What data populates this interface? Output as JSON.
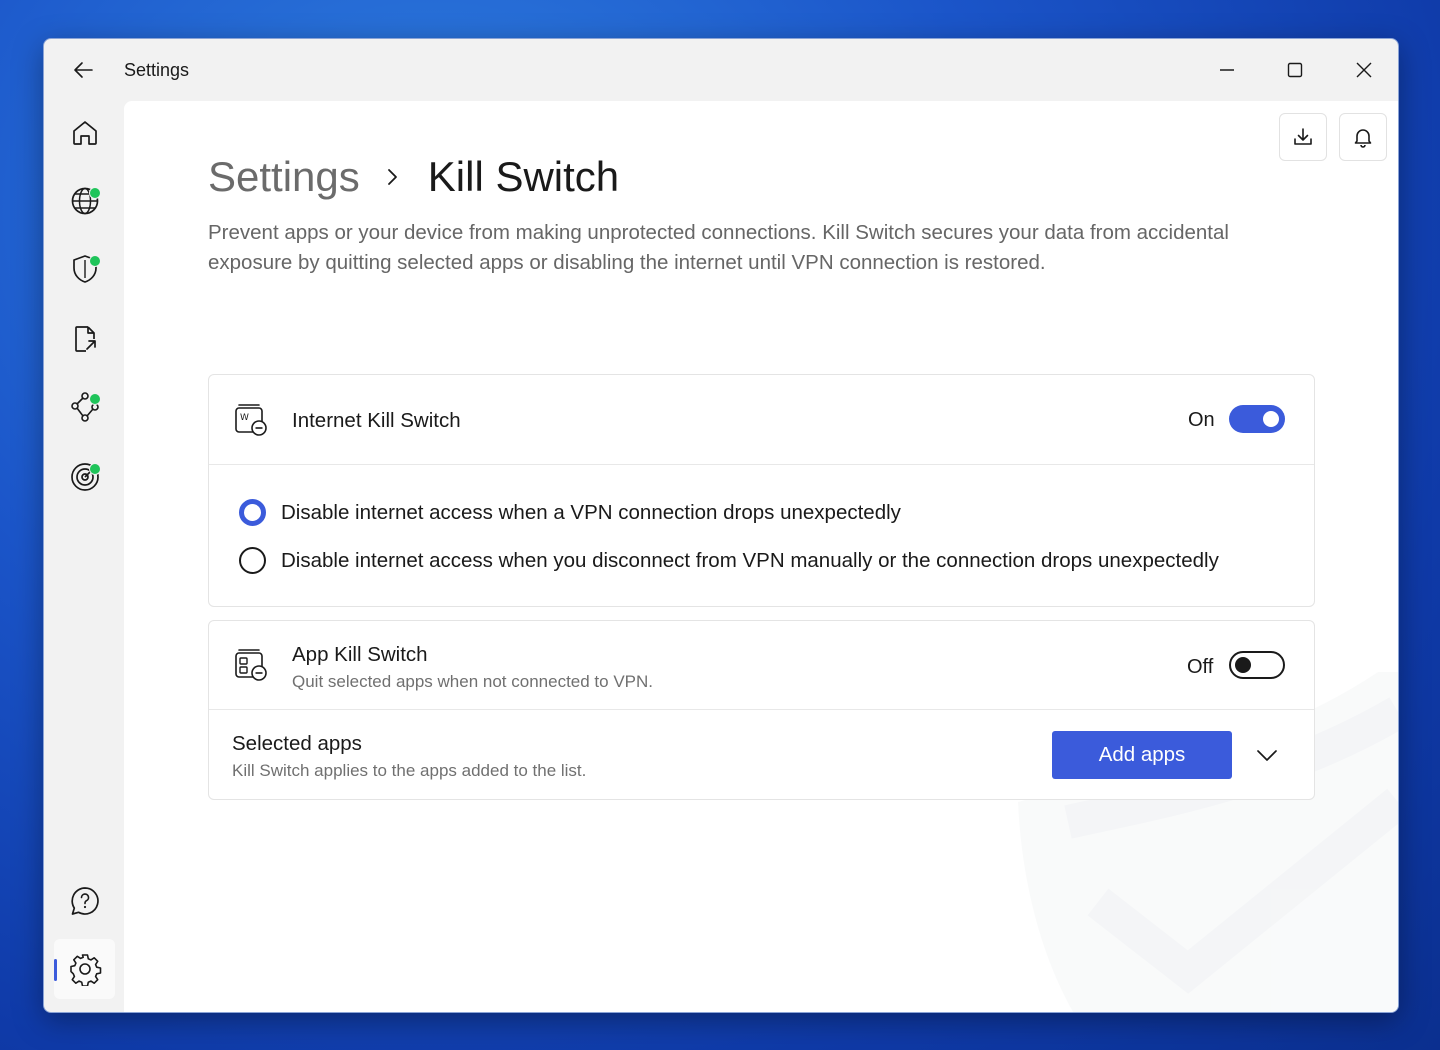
{
  "window": {
    "title": "Settings"
  },
  "colors": {
    "accent": "#3b5bdb",
    "status_dot": "#1fc45a"
  },
  "sidebar": {
    "items": [
      {
        "icon": "home-icon"
      },
      {
        "icon": "globe-icon",
        "status_dot": true
      },
      {
        "icon": "shield-icon",
        "status_dot": true
      },
      {
        "icon": "file-share-icon"
      },
      {
        "icon": "meshnet-icon",
        "status_dot": true
      },
      {
        "icon": "target-icon",
        "status_dot": true
      },
      {
        "icon": "help-icon"
      },
      {
        "icon": "gear-icon",
        "active": true
      }
    ]
  },
  "toolbar": {
    "download_icon": "download-icon",
    "bell_icon": "bell-icon"
  },
  "breadcrumb": {
    "parent": "Settings",
    "current": "Kill Switch"
  },
  "description": "Prevent apps or your device from making unprotected connections. Kill Switch secures your data from accidental exposure by quitting selected apps or disabling the internet until VPN connection is restored.",
  "internet_kill_switch": {
    "label": "Internet Kill Switch",
    "state_label": "On",
    "enabled": true,
    "options": [
      {
        "label": "Disable internet access when a VPN connection drops unexpectedly",
        "selected": true
      },
      {
        "label": "Disable internet access when you disconnect from VPN manually or the connection drops unexpectedly",
        "selected": false
      }
    ]
  },
  "app_kill_switch": {
    "label": "App Kill Switch",
    "sublabel": "Quit selected apps when not connected to VPN.",
    "state_label": "Off",
    "enabled": false
  },
  "selected_apps": {
    "label": "Selected apps",
    "sublabel": "Kill Switch applies to the apps added to the list.",
    "button_label": "Add apps"
  }
}
